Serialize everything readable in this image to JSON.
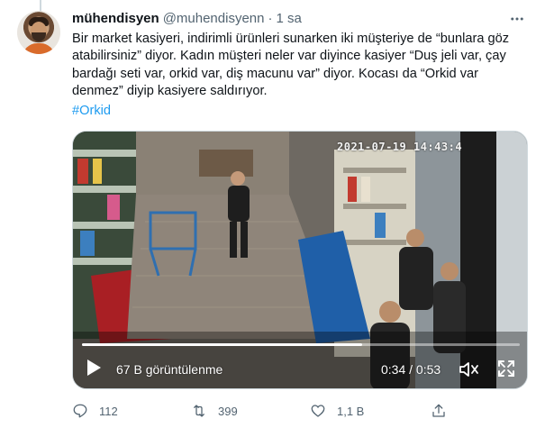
{
  "tweet": {
    "display_name": "mühendisyen",
    "handle": "@muhendisyenn",
    "separator": "·",
    "time": "1 sa",
    "text_lines": [
      "Bir market kasiyeri, indirimli ürünleri sunarken iki müşteriye de “bunlara göz",
      "atabilirsiniz” diyor. Kadın müşteri neler var diyince kasiyer “Duş jeli var, çay",
      "bardağı seti var, orkid var, diş macunu var” diyor. Kocası da “Orkid var",
      "denmez” diyip kasiyere saldırıyor."
    ],
    "hashtag": "#Orkid"
  },
  "video": {
    "camera_timestamp": "2021-07-19 14:43:4",
    "views_label": "67 B görüntülenme",
    "time_readout": "0:34 / 0:53",
    "progress_fraction": 0.64
  },
  "actions": {
    "replies": "112",
    "retweets": "399",
    "likes": "1,1 B",
    "share": ""
  },
  "icons": {
    "more": "more-horizontal-icon",
    "reply": "reply-icon",
    "retweet": "retweet-icon",
    "like": "heart-icon",
    "share": "share-icon",
    "play": "play-icon",
    "volume": "volume-icon",
    "fullscreen": "fullscreen-icon"
  },
  "colors": {
    "text": "#0f1419",
    "secondary": "#536471",
    "link": "#1d9bf0",
    "border": "#cfd9de"
  }
}
